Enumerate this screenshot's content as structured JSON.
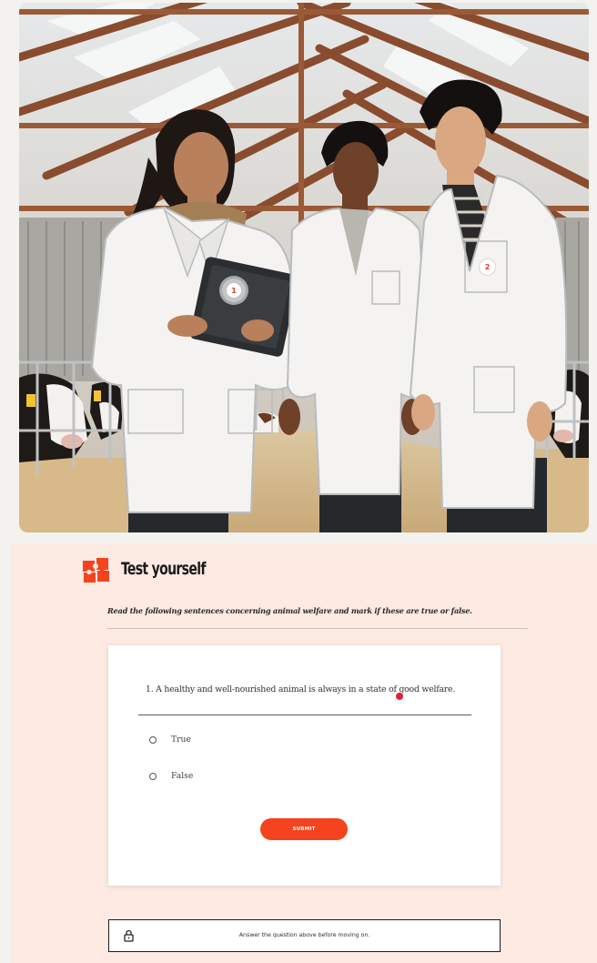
{
  "illustration": {
    "hotspots": [
      "1",
      "2"
    ]
  },
  "test_yourself": {
    "title": "Test yourself",
    "icon": "puzzle-icon",
    "instructions": "Read the following sentences concerning animal welfare and mark if these are true  or false.",
    "question": "1. A healthy and well-nourished animal is always in a state of good welfare.",
    "options": [
      "True",
      "False"
    ],
    "submit_label": "SUBMIT",
    "lock_message": "Answer the question above before moving on.",
    "accent_color": "#f4431e"
  }
}
